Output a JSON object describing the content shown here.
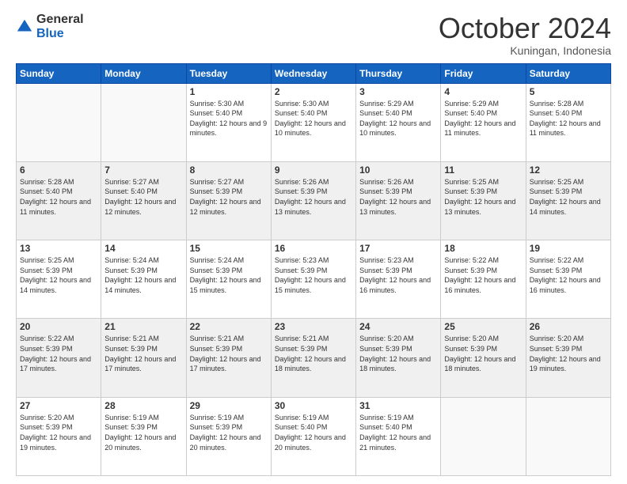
{
  "logo": {
    "general": "General",
    "blue": "Blue"
  },
  "header": {
    "month_year": "October 2024",
    "location": "Kuningan, Indonesia"
  },
  "days_of_week": [
    "Sunday",
    "Monday",
    "Tuesday",
    "Wednesday",
    "Thursday",
    "Friday",
    "Saturday"
  ],
  "weeks": [
    [
      {
        "day": "",
        "info": ""
      },
      {
        "day": "",
        "info": ""
      },
      {
        "day": "1",
        "info": "Sunrise: 5:30 AM\nSunset: 5:40 PM\nDaylight: 12 hours and 9 minutes."
      },
      {
        "day": "2",
        "info": "Sunrise: 5:30 AM\nSunset: 5:40 PM\nDaylight: 12 hours and 10 minutes."
      },
      {
        "day": "3",
        "info": "Sunrise: 5:29 AM\nSunset: 5:40 PM\nDaylight: 12 hours and 10 minutes."
      },
      {
        "day": "4",
        "info": "Sunrise: 5:29 AM\nSunset: 5:40 PM\nDaylight: 12 hours and 11 minutes."
      },
      {
        "day": "5",
        "info": "Sunrise: 5:28 AM\nSunset: 5:40 PM\nDaylight: 12 hours and 11 minutes."
      }
    ],
    [
      {
        "day": "6",
        "info": "Sunrise: 5:28 AM\nSunset: 5:40 PM\nDaylight: 12 hours and 11 minutes."
      },
      {
        "day": "7",
        "info": "Sunrise: 5:27 AM\nSunset: 5:40 PM\nDaylight: 12 hours and 12 minutes."
      },
      {
        "day": "8",
        "info": "Sunrise: 5:27 AM\nSunset: 5:39 PM\nDaylight: 12 hours and 12 minutes."
      },
      {
        "day": "9",
        "info": "Sunrise: 5:26 AM\nSunset: 5:39 PM\nDaylight: 12 hours and 13 minutes."
      },
      {
        "day": "10",
        "info": "Sunrise: 5:26 AM\nSunset: 5:39 PM\nDaylight: 12 hours and 13 minutes."
      },
      {
        "day": "11",
        "info": "Sunrise: 5:25 AM\nSunset: 5:39 PM\nDaylight: 12 hours and 13 minutes."
      },
      {
        "day": "12",
        "info": "Sunrise: 5:25 AM\nSunset: 5:39 PM\nDaylight: 12 hours and 14 minutes."
      }
    ],
    [
      {
        "day": "13",
        "info": "Sunrise: 5:25 AM\nSunset: 5:39 PM\nDaylight: 12 hours and 14 minutes."
      },
      {
        "day": "14",
        "info": "Sunrise: 5:24 AM\nSunset: 5:39 PM\nDaylight: 12 hours and 14 minutes."
      },
      {
        "day": "15",
        "info": "Sunrise: 5:24 AM\nSunset: 5:39 PM\nDaylight: 12 hours and 15 minutes."
      },
      {
        "day": "16",
        "info": "Sunrise: 5:23 AM\nSunset: 5:39 PM\nDaylight: 12 hours and 15 minutes."
      },
      {
        "day": "17",
        "info": "Sunrise: 5:23 AM\nSunset: 5:39 PM\nDaylight: 12 hours and 16 minutes."
      },
      {
        "day": "18",
        "info": "Sunrise: 5:22 AM\nSunset: 5:39 PM\nDaylight: 12 hours and 16 minutes."
      },
      {
        "day": "19",
        "info": "Sunrise: 5:22 AM\nSunset: 5:39 PM\nDaylight: 12 hours and 16 minutes."
      }
    ],
    [
      {
        "day": "20",
        "info": "Sunrise: 5:22 AM\nSunset: 5:39 PM\nDaylight: 12 hours and 17 minutes."
      },
      {
        "day": "21",
        "info": "Sunrise: 5:21 AM\nSunset: 5:39 PM\nDaylight: 12 hours and 17 minutes."
      },
      {
        "day": "22",
        "info": "Sunrise: 5:21 AM\nSunset: 5:39 PM\nDaylight: 12 hours and 17 minutes."
      },
      {
        "day": "23",
        "info": "Sunrise: 5:21 AM\nSunset: 5:39 PM\nDaylight: 12 hours and 18 minutes."
      },
      {
        "day": "24",
        "info": "Sunrise: 5:20 AM\nSunset: 5:39 PM\nDaylight: 12 hours and 18 minutes."
      },
      {
        "day": "25",
        "info": "Sunrise: 5:20 AM\nSunset: 5:39 PM\nDaylight: 12 hours and 18 minutes."
      },
      {
        "day": "26",
        "info": "Sunrise: 5:20 AM\nSunset: 5:39 PM\nDaylight: 12 hours and 19 minutes."
      }
    ],
    [
      {
        "day": "27",
        "info": "Sunrise: 5:20 AM\nSunset: 5:39 PM\nDaylight: 12 hours and 19 minutes."
      },
      {
        "day": "28",
        "info": "Sunrise: 5:19 AM\nSunset: 5:39 PM\nDaylight: 12 hours and 20 minutes."
      },
      {
        "day": "29",
        "info": "Sunrise: 5:19 AM\nSunset: 5:39 PM\nDaylight: 12 hours and 20 minutes."
      },
      {
        "day": "30",
        "info": "Sunrise: 5:19 AM\nSunset: 5:40 PM\nDaylight: 12 hours and 20 minutes."
      },
      {
        "day": "31",
        "info": "Sunrise: 5:19 AM\nSunset: 5:40 PM\nDaylight: 12 hours and 21 minutes."
      },
      {
        "day": "",
        "info": ""
      },
      {
        "day": "",
        "info": ""
      }
    ]
  ]
}
